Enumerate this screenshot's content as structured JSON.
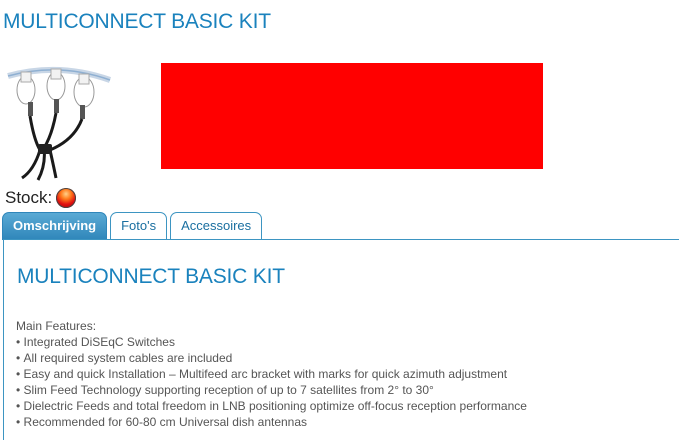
{
  "page": {
    "title": "MULTICONNECT BASIC KIT"
  },
  "product": {
    "image_icon": "multiconnect-lnb-product-image",
    "banner_color": "#ff0000",
    "stock_label": "Stock:",
    "stock_status_color": "#e01010"
  },
  "tabs": [
    {
      "label": "Omschrijving",
      "active": true
    },
    {
      "label": "Foto's",
      "active": false
    },
    {
      "label": "Accessoires",
      "active": false
    }
  ],
  "content": {
    "title": "MULTICONNECT BASIC KIT",
    "features_heading": "Main Features:",
    "features": [
      "Integrated DiSEqC Switches",
      "All required system cables are included",
      "Easy and quick Installation – Multifeed arc bracket with marks for quick azimuth adjustment",
      "Slim Feed Technology supporting reception of up to 7 satellites from 2° to 30°",
      "Dielectric Feeds and total freedom in LNB positioning optimize off-focus reception performance",
      "Recommended for 60-80 cm Universal dish antennas"
    ]
  },
  "colors": {
    "accent": "#1a82bd",
    "tab_border": "#3d95c2",
    "text": "#555555"
  }
}
